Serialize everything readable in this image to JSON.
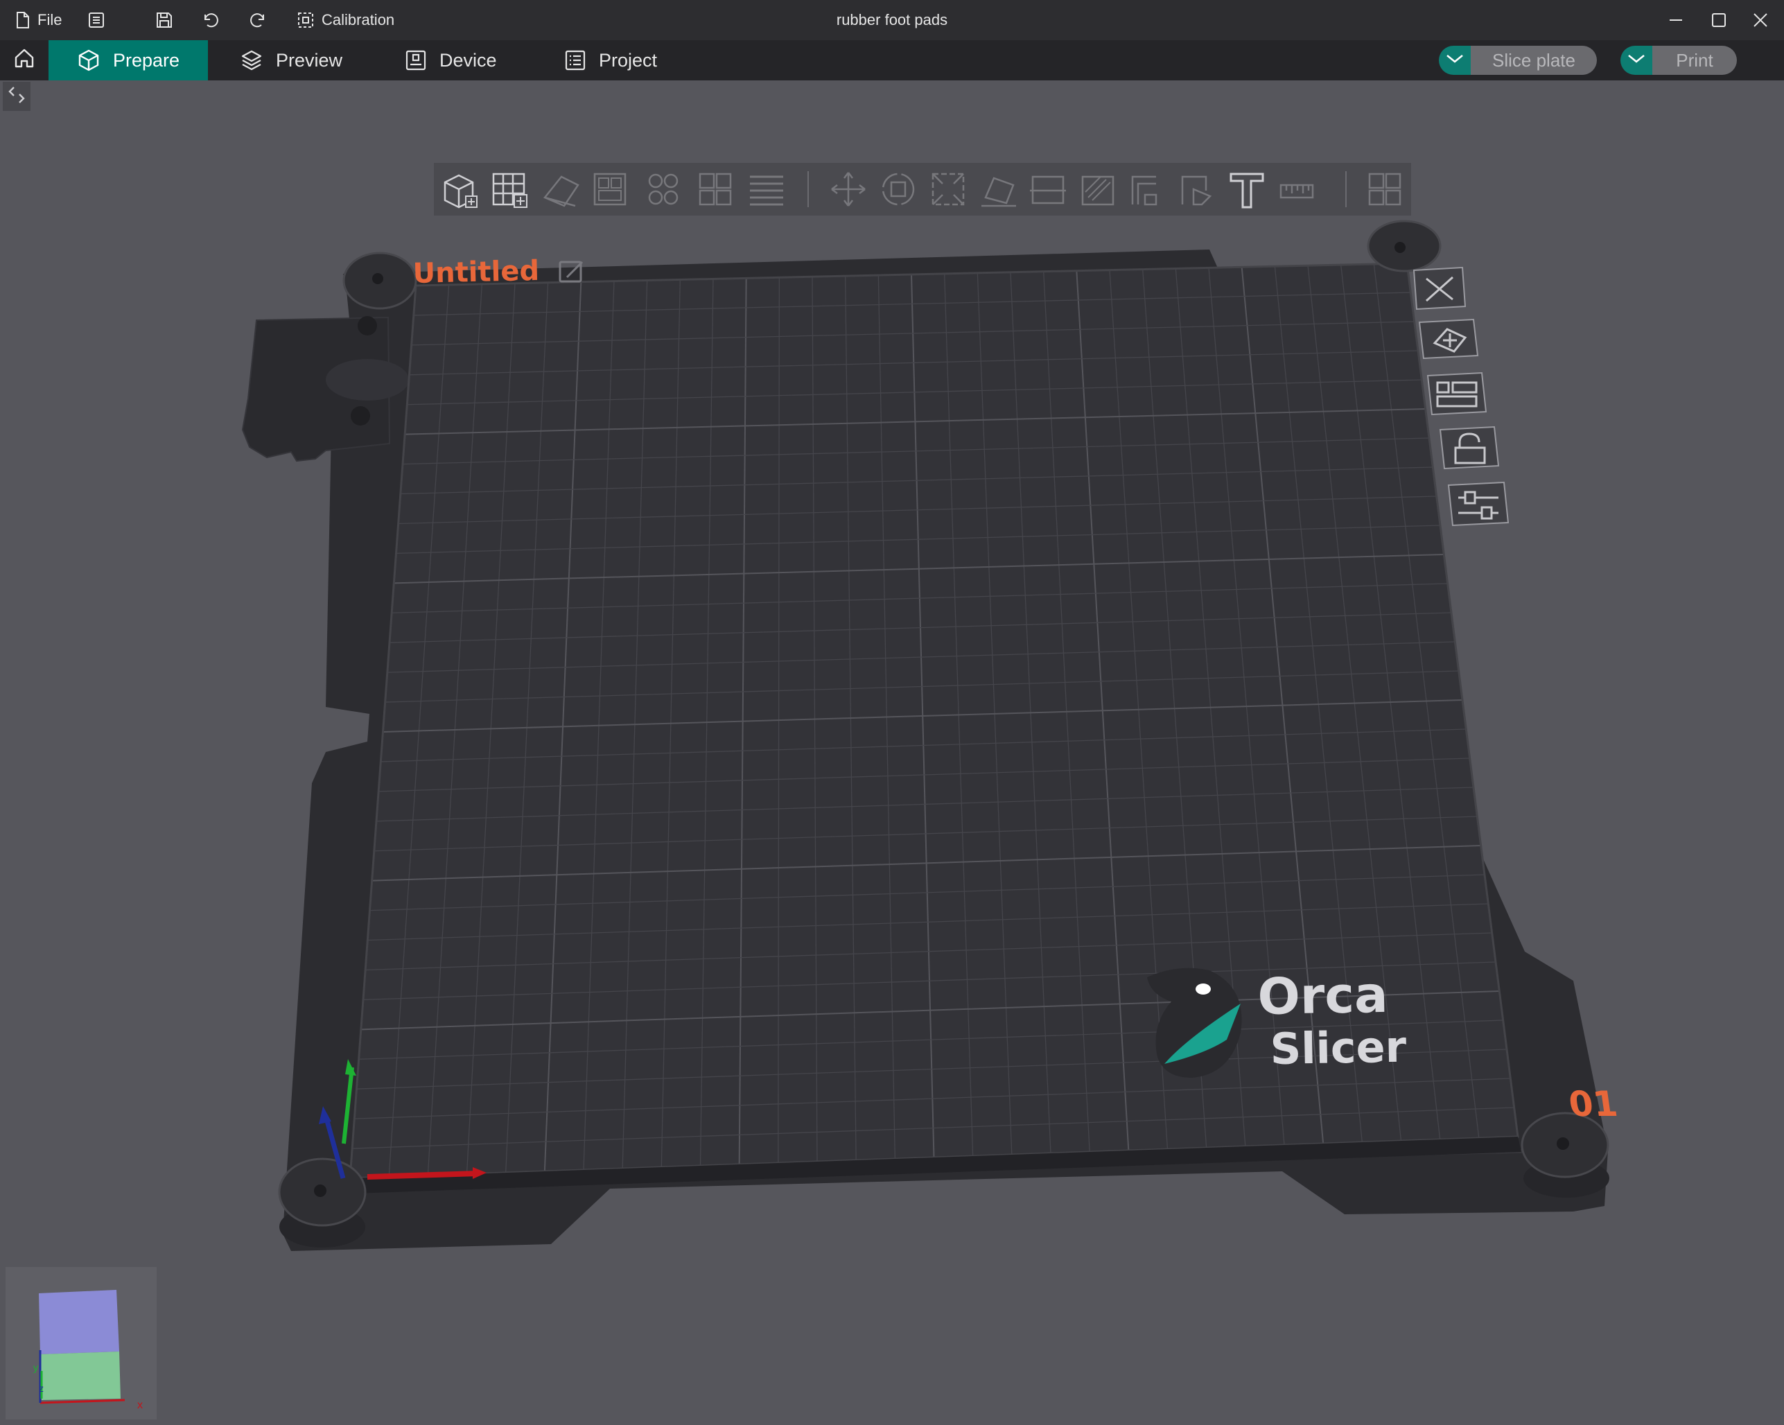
{
  "titlebar": {
    "file_label": "File",
    "calibration_label": "Calibration",
    "window_title": "rubber foot pads",
    "icons": [
      "file-icon",
      "menu-icon",
      "save-icon",
      "undo-icon",
      "redo-icon",
      "calibration-icon",
      "minimize-icon",
      "maximize-icon",
      "close-icon"
    ]
  },
  "tabs": [
    {
      "label": "Prepare",
      "icon": "cube-icon",
      "active": true
    },
    {
      "label": "Preview",
      "icon": "layers-icon",
      "active": false
    },
    {
      "label": "Device",
      "icon": "device-icon",
      "active": false
    },
    {
      "label": "Project",
      "icon": "project-icon",
      "active": false
    }
  ],
  "actions": {
    "slice_label": "Slice plate",
    "print_label": "Print"
  },
  "plate": {
    "name": "Untitled",
    "number": "01",
    "logo_line1": "Orca",
    "logo_line2": "Slicer"
  },
  "colors": {
    "accent": "#00786c",
    "plate_label": "#e8673a",
    "bed": "#333338",
    "grid": "#4a4a50"
  },
  "toolbar_icons": [
    "add-object-icon",
    "add-plate-icon",
    "orient-icon",
    "arrange-icon",
    "split-objects-icon",
    "split-parts-icon",
    "layers-editing-icon",
    "move-icon",
    "rotate-icon",
    "scale-icon",
    "lay-on-face-icon",
    "cut-icon",
    "support-paint-icon",
    "seam-paint-icon",
    "color-paint-icon",
    "text-icon",
    "measure-icon",
    "assembly-icon"
  ],
  "plate_icons": [
    "delete-plate-icon",
    "orient-plate-icon",
    "arrange-plate-icon",
    "lock-plate-icon",
    "plate-settings-icon"
  ],
  "nav_cube": {
    "axis_x": "x",
    "axis_y": "y",
    "axis_z": "z"
  }
}
